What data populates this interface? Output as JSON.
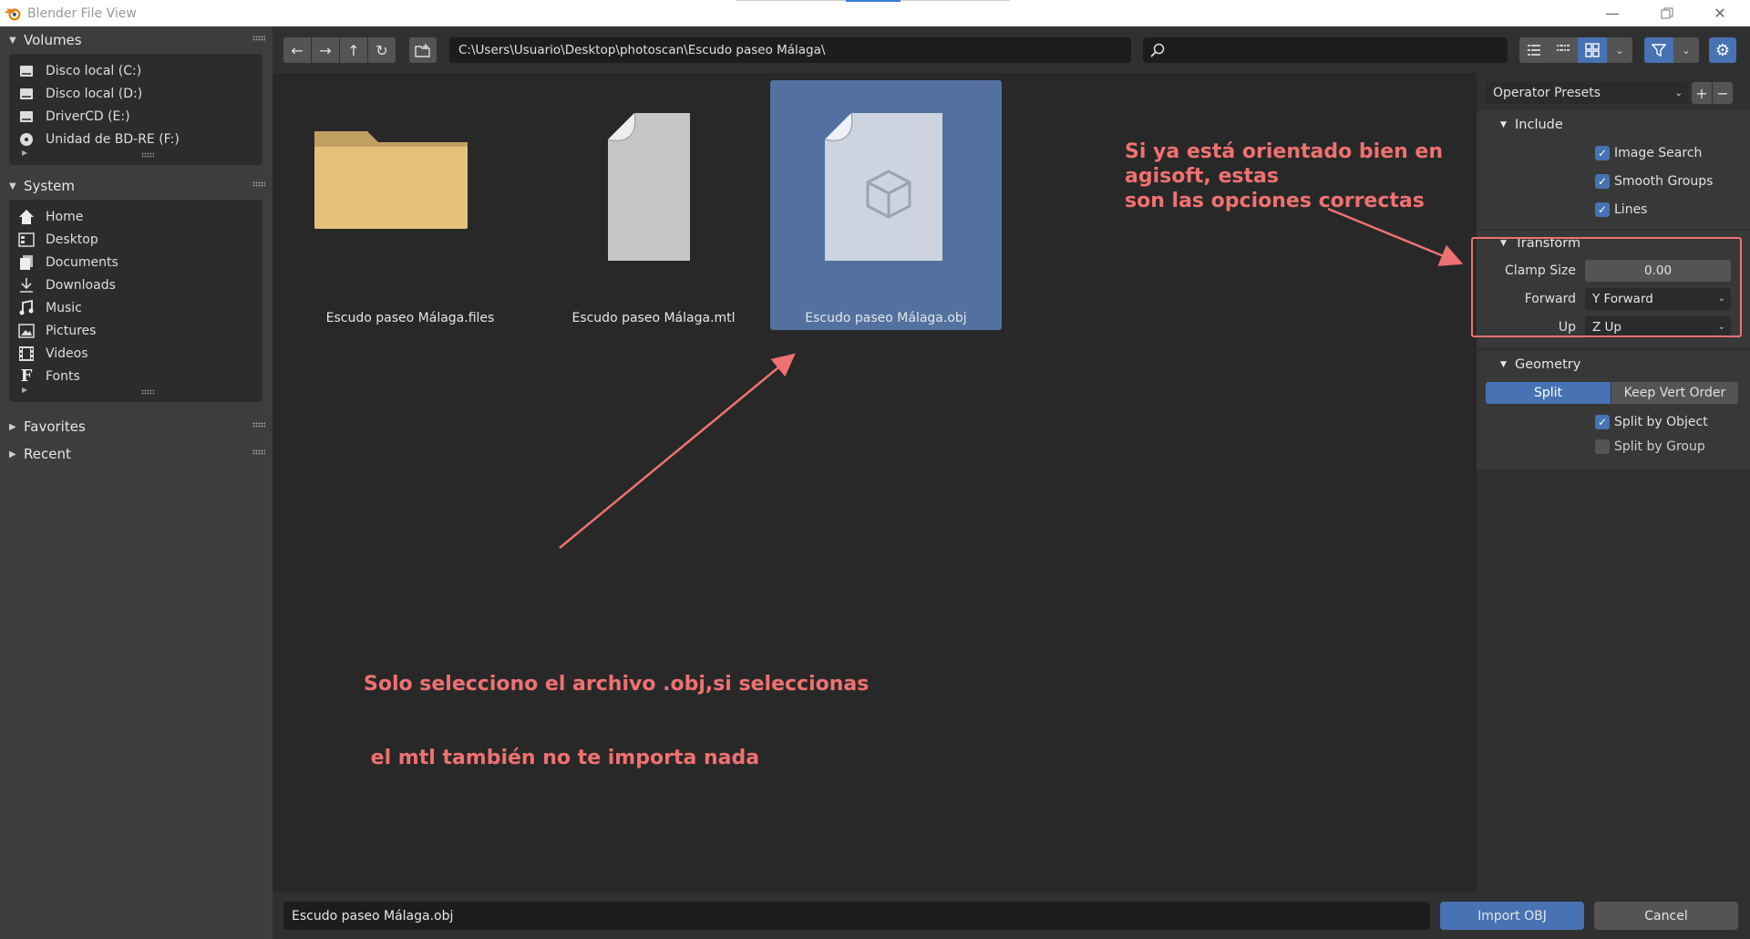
{
  "window": {
    "title": "Blender File View"
  },
  "sidebar": {
    "volumes": {
      "header": "Volumes",
      "items": [
        {
          "label": "Disco local (C:)",
          "icon": "drive-icon"
        },
        {
          "label": "Disco local (D:)",
          "icon": "drive-icon"
        },
        {
          "label": "DriverCD (E:)",
          "icon": "drive-icon"
        },
        {
          "label": "Unidad de BD-RE (F:)",
          "icon": "disc-icon"
        }
      ]
    },
    "system": {
      "header": "System",
      "items": [
        {
          "label": "Home",
          "icon": "home-icon"
        },
        {
          "label": "Desktop",
          "icon": "desktop-icon"
        },
        {
          "label": "Documents",
          "icon": "documents-icon"
        },
        {
          "label": "Downloads",
          "icon": "download-icon"
        },
        {
          "label": "Music",
          "icon": "music-icon"
        },
        {
          "label": "Pictures",
          "icon": "pictures-icon"
        },
        {
          "label": "Videos",
          "icon": "videos-icon"
        },
        {
          "label": "Fonts",
          "icon": "font-icon"
        }
      ]
    },
    "favorites": {
      "header": "Favorites"
    },
    "recent": {
      "header": "Recent"
    }
  },
  "toolbar": {
    "path": "C:\\Users\\Usuario\\Desktop\\photoscan\\Escudo paseo Málaga\\",
    "search_value": ""
  },
  "files": [
    {
      "name": "Escudo paseo Málaga.files",
      "type": "folder",
      "selected": false
    },
    {
      "name": "Escudo paseo Málaga.mtl",
      "type": "file",
      "selected": false
    },
    {
      "name": "Escudo paseo Málaga.obj",
      "type": "mesh-file",
      "selected": true
    }
  ],
  "annotations": {
    "right_note_line1": "Si ya está orientado bien en agisoft, estas",
    "right_note_line2": "son las opciones correctas",
    "bottom_note_line1": "Solo selecciono el archivo .obj,si seleccionas",
    "bottom_note_line2": " el mtl también no te importa nada",
    "color": "#f07171"
  },
  "panel": {
    "presets_label": "Operator Presets",
    "include": {
      "header": "Include",
      "image_search": {
        "label": "Image Search",
        "checked": true
      },
      "smooth_groups": {
        "label": "Smooth Groups",
        "checked": true
      },
      "lines": {
        "label": "Lines",
        "checked": true
      }
    },
    "transform": {
      "header": "Transform",
      "clamp_size_label": "Clamp Size",
      "clamp_size_value": "0.00",
      "forward_label": "Forward",
      "forward_value": "Y Forward",
      "up_label": "Up",
      "up_value": "Z Up"
    },
    "geometry": {
      "header": "Geometry",
      "split_label": "Split",
      "keep_vert_order_label": "Keep Vert Order",
      "split_by_object": {
        "label": "Split by Object",
        "checked": true
      },
      "split_by_group": {
        "label": "Split by Group",
        "checked": false
      }
    }
  },
  "bottom": {
    "filename": "Escudo paseo Málaga.obj",
    "import_label": "Import OBJ",
    "cancel_label": "Cancel"
  },
  "colors": {
    "accent": "#4772b3",
    "selected_tile": "#5271a0",
    "annotation": "#f07171"
  }
}
